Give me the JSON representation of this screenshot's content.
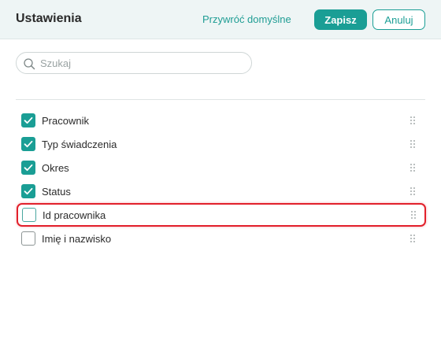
{
  "header": {
    "title": "Ustawienia",
    "reset_label": "Przywróć domyślne",
    "save_label": "Zapisz",
    "cancel_label": "Anuluj"
  },
  "search": {
    "placeholder": "Szukaj",
    "value": ""
  },
  "colors": {
    "accent": "#1a9e95",
    "highlight": "#e2202b",
    "header_bg": "#eef5f5"
  },
  "columns": [
    {
      "label": "Pracownik",
      "checked": true,
      "highlighted": false
    },
    {
      "label": "Typ świadczenia",
      "checked": true,
      "highlighted": false
    },
    {
      "label": "Okres",
      "checked": true,
      "highlighted": false
    },
    {
      "label": "Status",
      "checked": true,
      "highlighted": false
    },
    {
      "label": "Id pracownika",
      "checked": false,
      "highlighted": true
    },
    {
      "label": "Imię i nazwisko",
      "checked": false,
      "highlighted": false
    }
  ]
}
